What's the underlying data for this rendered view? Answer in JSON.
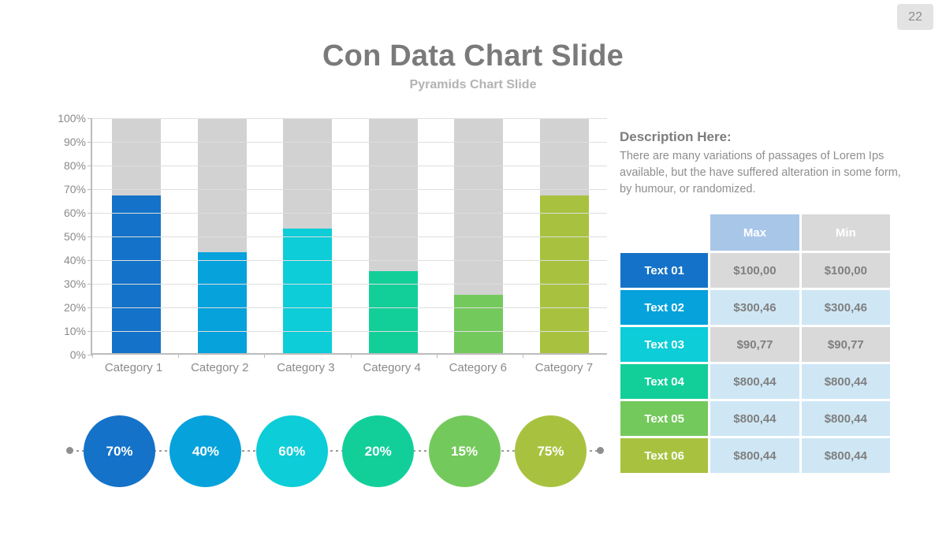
{
  "page_number": "22",
  "header": {
    "title": "Con Data Chart Slide",
    "subtitle": "Pyramids Chart Slide"
  },
  "description": {
    "heading": "Description Here:",
    "body": "There are many variations of passages  of Lorem Ips available, but the have suffered alteration in some  form, by humour, or randomized."
  },
  "chart_data": {
    "type": "bar",
    "title": "",
    "xlabel": "",
    "ylabel": "",
    "ylim": [
      0,
      100
    ],
    "grid": true,
    "legend": "none",
    "categories": [
      "Category 1",
      "Category 2",
      "Category 3",
      "Category 4",
      "Category 6",
      "Category 7"
    ],
    "values": [
      67,
      43,
      53,
      35,
      25,
      67
    ],
    "background_track_value": 100,
    "ytick_labels": [
      "0%",
      "10%",
      "20%",
      "30%",
      "40%",
      "50%",
      "60%",
      "70%",
      "80%",
      "90%",
      "100%"
    ],
    "ytick_values": [
      0,
      10,
      20,
      30,
      40,
      50,
      60,
      70,
      80,
      90,
      100
    ],
    "colors": [
      "#1472c8",
      "#06a2dc",
      "#0ccdd8",
      "#12cf9a",
      "#74c95c",
      "#a8c23f"
    ],
    "track_color": "#d2d2d2"
  },
  "circles": [
    {
      "label": "70%",
      "color": "#1472c8"
    },
    {
      "label": "40%",
      "color": "#06a2dc"
    },
    {
      "label": "60%",
      "color": "#0ccdd8"
    },
    {
      "label": "20%",
      "color": "#12cf9a"
    },
    {
      "label": "15%",
      "color": "#74c95c"
    },
    {
      "label": "75%",
      "color": "#a8c23f"
    }
  ],
  "table": {
    "columns": [
      "",
      "Max",
      "Min"
    ],
    "header_colors": [
      "transparent",
      "#a8c6e8",
      "#d9d9d9"
    ],
    "rows": [
      {
        "label": "Text 01",
        "max": "$100,00",
        "min": "$100,00",
        "label_color": "#1472c8",
        "cell_color": "#d9d9d9"
      },
      {
        "label": "Text 02",
        "max": "$300,46",
        "min": "$300,46",
        "label_color": "#06a2dc",
        "cell_color": "#cfe7f5"
      },
      {
        "label": "Text 03",
        "max": "$90,77",
        "min": "$90,77",
        "label_color": "#0ccdd8",
        "cell_color": "#d9d9d9"
      },
      {
        "label": "Text 04",
        "max": "$800,44",
        "min": "$800,44",
        "label_color": "#12cf9a",
        "cell_color": "#cfe7f5"
      },
      {
        "label": "Text 05",
        "max": "$800,44",
        "min": "$800,44",
        "label_color": "#74c95c",
        "cell_color": "#cfe7f5"
      },
      {
        "label": "Text 06",
        "max": "$800,44",
        "min": "$800,44",
        "label_color": "#a8c23f",
        "cell_color": "#cfe7f5"
      }
    ]
  }
}
